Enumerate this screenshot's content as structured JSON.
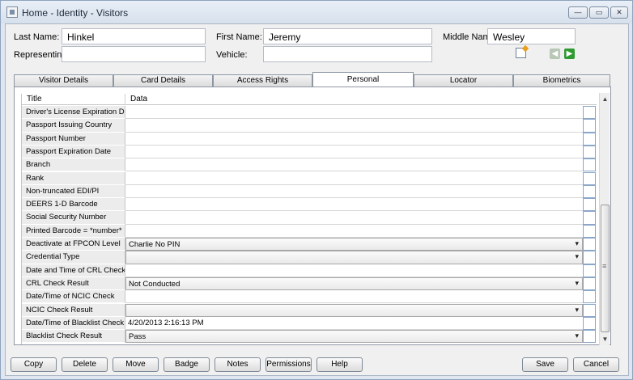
{
  "window": {
    "title": "Home - Identity - Visitors",
    "min_glyph": "—",
    "max_glyph": "▭",
    "close_glyph": "✕"
  },
  "form": {
    "last_name_label": "Last Name:",
    "last_name_value": "Hinkel",
    "first_name_label": "First Name:",
    "first_name_value": "Jeremy",
    "middle_name_label": "Middle Name:",
    "middle_name_value": "Wesley",
    "representing_label": "Representing:",
    "representing_value": "",
    "vehicle_label": "Vehicle:",
    "vehicle_value": "",
    "icons": {
      "edit": "edit-icon",
      "prev": "arrow-left-icon",
      "next": "arrow-right-icon"
    },
    "prev_glyph": "◀",
    "next_glyph": "▶"
  },
  "tabs": [
    "Visitor Details",
    "Card Details",
    "Access Rights",
    "Personal",
    "Locator",
    "Biometrics"
  ],
  "active_tab": "Personal",
  "grid": {
    "headers": {
      "title": "Title",
      "data": "Data"
    },
    "rows": [
      {
        "title": "Driver's License Expiration Date",
        "data": "",
        "type": "text"
      },
      {
        "title": "Passport Issuing Country",
        "data": "",
        "type": "text"
      },
      {
        "title": "Passport Number",
        "data": "",
        "type": "text"
      },
      {
        "title": "Passport Expiration Date",
        "data": "",
        "type": "text"
      },
      {
        "title": "Branch",
        "data": "",
        "type": "text"
      },
      {
        "title": "Rank",
        "data": "",
        "type": "text"
      },
      {
        "title": "Non-truncated EDI/PI",
        "data": "",
        "type": "text"
      },
      {
        "title": "DEERS 1-D Barcode",
        "data": "",
        "type": "text"
      },
      {
        "title": "Social Security Number",
        "data": "",
        "type": "text"
      },
      {
        "title": "Printed Barcode = *number*",
        "data": "",
        "type": "text"
      },
      {
        "title": "Deactivate at FPCON Level",
        "data": "Charlie No PIN",
        "type": "select"
      },
      {
        "title": "Credential Type",
        "data": "",
        "type": "select"
      },
      {
        "title": "Date and Time of CRL Check",
        "data": "",
        "type": "text"
      },
      {
        "title": "CRL Check Result",
        "data": "Not Conducted",
        "type": "select"
      },
      {
        "title": "Date/Time of NCIC Check",
        "data": "",
        "type": "text"
      },
      {
        "title": "NCIC Check Result",
        "data": "",
        "type": "select"
      },
      {
        "title": "Date/Time of Blacklist Check",
        "data": "4/20/2013 2:16:13 PM",
        "type": "text"
      },
      {
        "title": "Blacklist Check Result",
        "data": "Pass",
        "type": "select"
      }
    ]
  },
  "scrollbar": {
    "up_glyph": "▲",
    "down_glyph": "▼"
  },
  "buttons": {
    "copy": "Copy",
    "delete": "Delete",
    "move": "Move",
    "badge": "Badge",
    "notes": "Notes",
    "permissions": "Permissions",
    "help": "Help",
    "save": "Save",
    "cancel": "Cancel"
  }
}
